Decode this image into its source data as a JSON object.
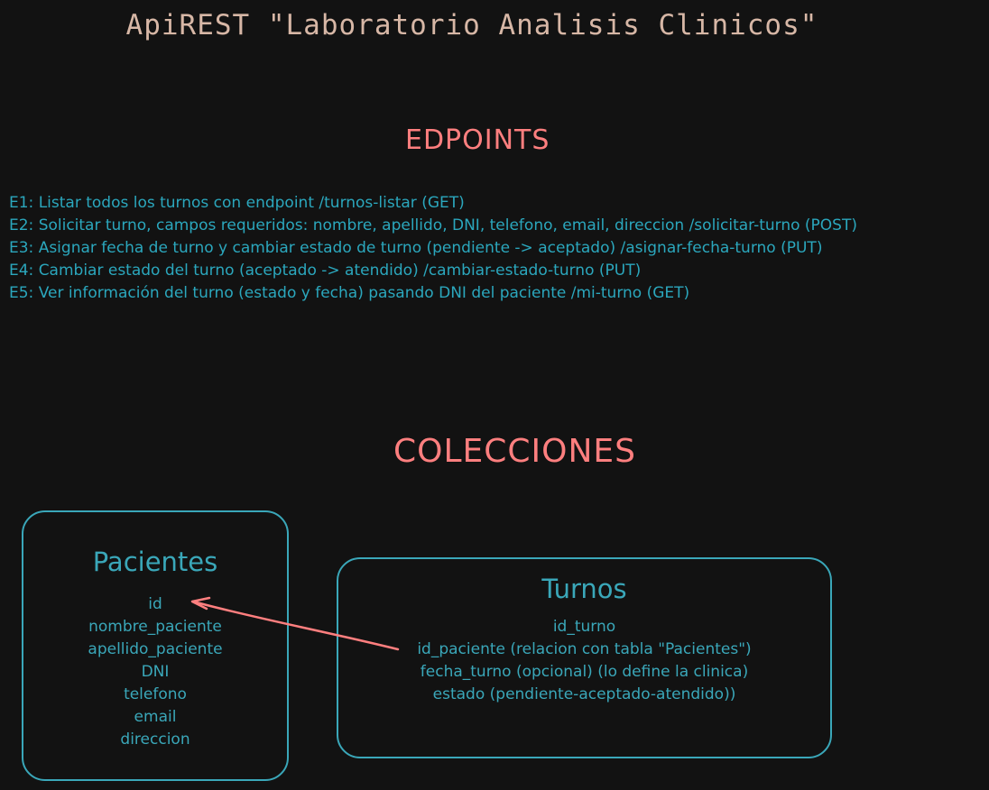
{
  "title": "ApiREST \"Laboratorio Analisis Clinicos\"",
  "endpoints_heading": "EDPOINTS",
  "endpoints": [
    "E1: Listar todos los turnos con endpoint /turnos-listar (GET)",
    "E2: Solicitar turno, campos requeridos: nombre, apellido, DNI, telefono, email, direccion /solicitar-turno (POST)",
    "E3: Asignar fecha de turno y cambiar estado de turno (pendiente -> aceptado) /asignar-fecha-turno (PUT)",
    "E4: Cambiar estado del turno (aceptado -> atendido) /cambiar-estado-turno (PUT)",
    "E5: Ver información del turno (estado y fecha) pasando DNI del paciente /mi-turno (GET)"
  ],
  "collections_heading": "COLECCIONES",
  "pacientes": {
    "title": "Pacientes",
    "fields": [
      "id",
      "nombre_paciente",
      "apellido_paciente",
      "DNI",
      "telefono",
      "email",
      "direccion"
    ]
  },
  "turnos": {
    "title": "Turnos",
    "fields": [
      "id_turno",
      "id_paciente (relacion con tabla \"Pacientes\")",
      "fecha_turno (opcional) (lo define la clinica)",
      "estado (pendiente-aceptado-atendido))"
    ]
  },
  "colors": {
    "background": "#121212",
    "title": "#d7b7a6",
    "heading": "#ff7f7f",
    "text": "#2ba7bd",
    "box": "#3aa7b9",
    "relation_arrow": "#ff7f7f"
  }
}
